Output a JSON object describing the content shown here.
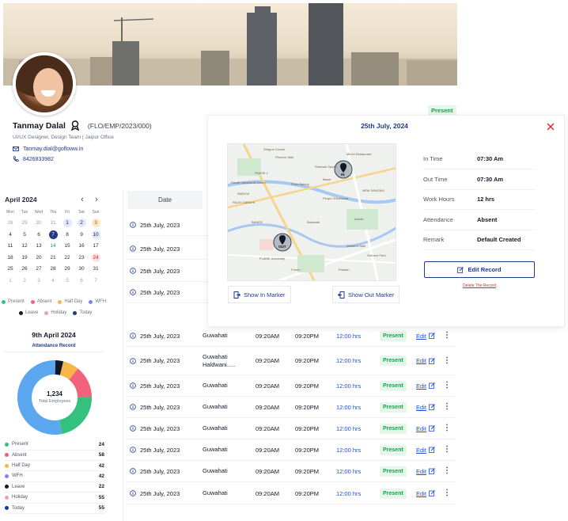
{
  "profile": {
    "name": "Tanmay Dalal",
    "emp_code": "(FLO/EMP/2023/000)",
    "role": "UI/UX Designer, Design Team  |  Jaipur Office",
    "email": "Tanmay.dial@gofloww.in",
    "phone": "8426833982"
  },
  "calendar": {
    "title": "April 2024",
    "weekdays": [
      "Mon",
      "Tue",
      "Wed",
      "Thu",
      "Fri",
      "Sat",
      "Sun"
    ],
    "days": [
      "28",
      "29",
      "30",
      "31",
      "1",
      "2",
      "3",
      "4",
      "5",
      "6",
      "7",
      "8",
      "9",
      "10",
      "11",
      "12",
      "13",
      "14",
      "15",
      "16",
      "17",
      "18",
      "19",
      "20",
      "21",
      "22",
      "23",
      "24",
      "25",
      "26",
      "27",
      "28",
      "29",
      "30",
      "31",
      "1",
      "2",
      "3",
      "4",
      "5",
      "6",
      "7"
    ],
    "legend": [
      "Present",
      "Absent",
      "Half Day",
      "WFH",
      "Leave",
      "Holiday",
      "Today"
    ]
  },
  "summary": {
    "date": "9th April 2024",
    "subtitle": "Attendance Record",
    "total": "1,234",
    "total_label": "Total Employees",
    "stats": [
      {
        "label": "Present",
        "value": "24"
      },
      {
        "label": "Absent",
        "value": "58"
      },
      {
        "label": "Half Day",
        "value": "42"
      },
      {
        "label": "WFH",
        "value": "42"
      },
      {
        "label": "Leave",
        "value": "22"
      },
      {
        "label": "Holiday",
        "value": "55"
      },
      {
        "label": "Today",
        "value": "55"
      }
    ],
    "colors": {
      "present": "#34c17e",
      "absent": "#f2637b",
      "half_day": "#f7b64a",
      "wfh": "#7c83f5",
      "leave": "#111827",
      "holiday": "#f29ac5",
      "today": "#1e3a8a",
      "donut_main": "#5aa7f0"
    }
  },
  "table": {
    "date_header": "Date",
    "rows": [
      {
        "date": "25th July, 2023",
        "loc": "",
        "in": "",
        "out": "",
        "hrs": "",
        "status": "",
        "edit": ""
      },
      {
        "date": "25th July, 2023",
        "loc": "",
        "in": "",
        "out": "",
        "hrs": "",
        "status": "",
        "edit": ""
      },
      {
        "date": "25th July, 2023",
        "loc": "",
        "in": "",
        "out": "",
        "hrs": "",
        "status": "",
        "edit": ""
      },
      {
        "date": "25th July, 2023",
        "loc": "",
        "in": "",
        "out": "",
        "hrs": "",
        "status": "",
        "edit": ""
      },
      {
        "date": "25th July, 2023",
        "loc": "Guwahati",
        "in": "09:20AM",
        "out": "09:20PM",
        "hrs": "12:00 hrs",
        "status": "Present",
        "edit": "Edit"
      },
      {
        "date": "25th July, 2023",
        "loc": "Guwahati Haldwani.....",
        "in": "09:20AM",
        "out": "09:20PM",
        "hrs": "12:00 hrs",
        "status": "Present",
        "edit": "Edit"
      },
      {
        "date": "25th July, 2023",
        "loc": "Guwahati",
        "in": "09:20AM",
        "out": "09:20PM",
        "hrs": "12:00 hrs",
        "status": "Present",
        "edit": "Edit"
      },
      {
        "date": "25th July, 2023",
        "loc": "Guwahati",
        "in": "09:20AM",
        "out": "09:20PM",
        "hrs": "12:00 hrs",
        "status": "Present",
        "edit": "Edit"
      },
      {
        "date": "25th July, 2023",
        "loc": "Guwahati",
        "in": "09:20AM",
        "out": "09:20PM",
        "hrs": "12:00 hrs",
        "status": "Present",
        "edit": "Edit"
      },
      {
        "date": "25th July, 2023",
        "loc": "Guwahati",
        "in": "09:20AM",
        "out": "09:20PM",
        "hrs": "12:00 hrs",
        "status": "Present",
        "edit": "Edit"
      },
      {
        "date": "25th July, 2023",
        "loc": "Guwahati",
        "in": "09:20AM",
        "out": "09:20PM",
        "hrs": "12:00 hrs",
        "status": "Present",
        "edit": "Edit"
      },
      {
        "date": "25th July, 2023",
        "loc": "Guwahati",
        "in": "09:20AM",
        "out": "09:20PM",
        "hrs": "12:00 hrs",
        "status": "Present",
        "edit": "Edit"
      }
    ]
  },
  "detail": {
    "date": "25th July, 2024",
    "status_badge": "Present",
    "fields": [
      {
        "key": "In Time",
        "value": "07:30 Am"
      },
      {
        "key": "Out Time",
        "value": "07:30 Am"
      },
      {
        "key": "Work Hours",
        "value": "12 hrs"
      },
      {
        "key": "Attendance",
        "value": "Absent"
      },
      {
        "key": "Remark",
        "value": "Default Created"
      }
    ],
    "edit_label": "Edit Record",
    "delete_label": "Delete The Record",
    "show_in": "Show In Marker",
    "show_out": "Show Out Marker",
    "map": {
      "in_label": "IN",
      "out_label": "OUT",
      "places": [
        "Shagun Chowk",
        "Pandit Jawaharlal Nehru",
        "SANGVI",
        "PHASE 1",
        "RAJIV GANDHI",
        "Phoenix Mall",
        "Sharada Sports",
        "Pune Bakery",
        "Baner",
        "Mirchi Restaurant",
        "Pimpri Chinchwad",
        "Balewadi",
        "Aundh",
        "BANER",
        "NEW SANGAVI",
        "Westend Mall",
        "Pashan",
        "Forum",
        "Science Park",
        "FLAME University"
      ]
    }
  }
}
